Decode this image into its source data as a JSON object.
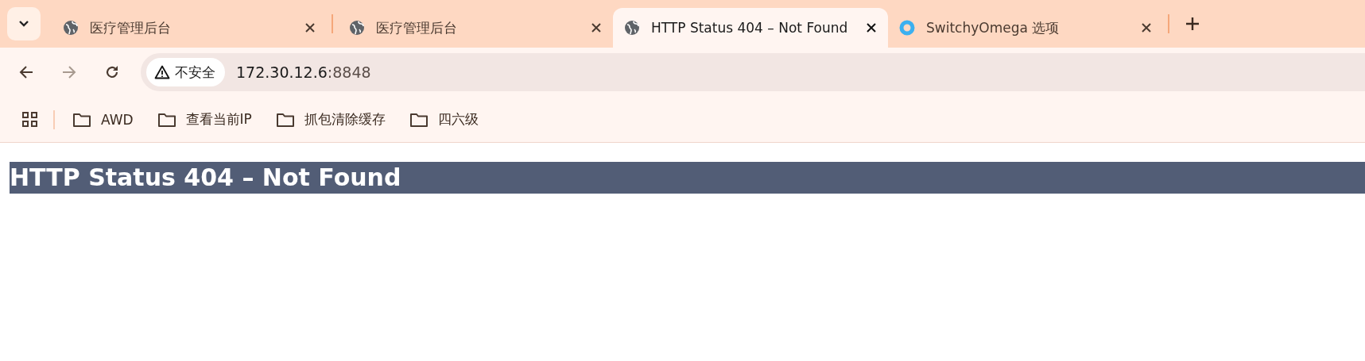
{
  "tabs": [
    {
      "title": "医疗管理后台",
      "kind": "globe",
      "selected": false
    },
    {
      "title": "医疗管理后台",
      "kind": "globe",
      "selected": false
    },
    {
      "title": "HTTP Status 404 – Not Found",
      "kind": "globe",
      "selected": true
    },
    {
      "title": "SwitchyOmega 选项",
      "kind": "ring",
      "selected": false
    }
  ],
  "toolbar": {
    "security_label": "不安全",
    "address_host": "172.30.12.6",
    "address_port": ":8848"
  },
  "bookmarks": [
    {
      "label": "AWD"
    },
    {
      "label": "查看当前IP"
    },
    {
      "label": "抓包清除缓存"
    },
    {
      "label": "四六级"
    }
  ],
  "page": {
    "heading": "HTTP Status 404 – Not Found"
  }
}
